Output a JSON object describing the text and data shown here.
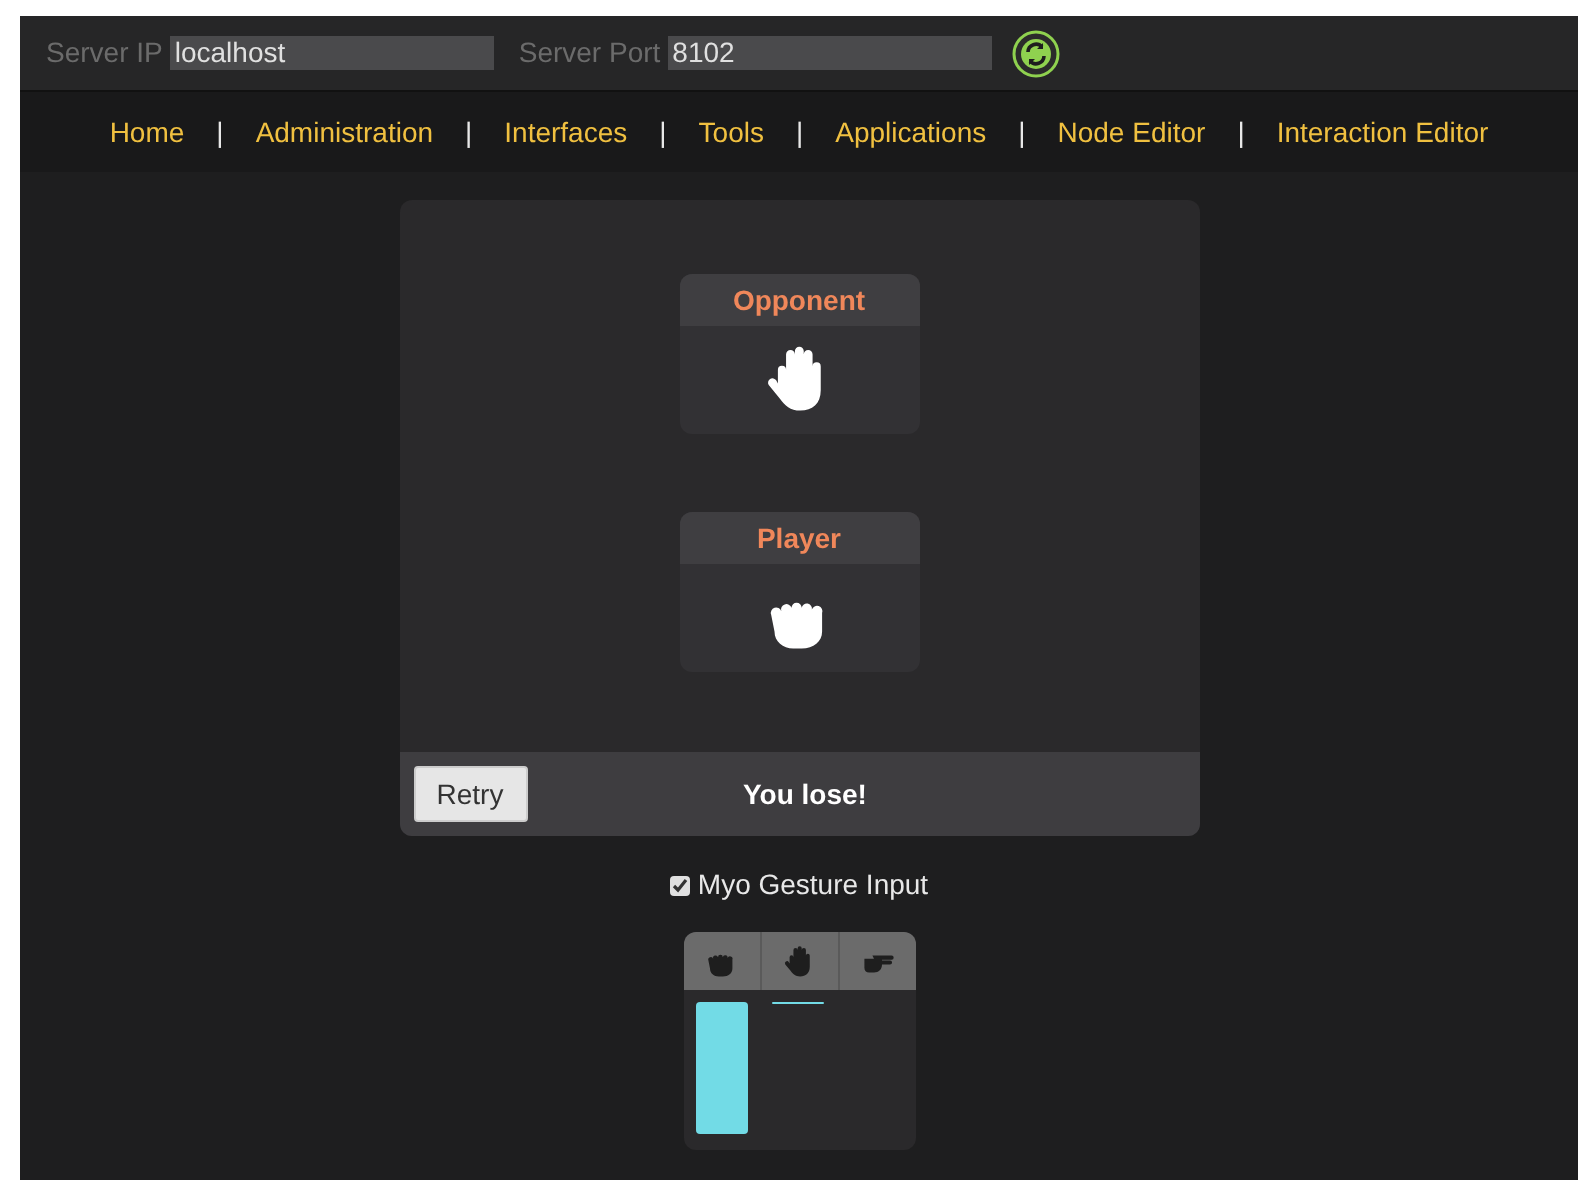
{
  "server": {
    "ip_label": "Server IP",
    "ip_value": "localhost",
    "port_label": "Server Port",
    "port_value": "8102"
  },
  "nav": [
    "Home",
    "Administration",
    "Interfaces",
    "Tools",
    "Applications",
    "Node Editor",
    "Interaction Editor"
  ],
  "nav_separator": "|",
  "game": {
    "hands": [
      {
        "title": "Opponent",
        "kind": "paper"
      },
      {
        "title": "Player",
        "kind": "rock"
      }
    ],
    "retry": "Retry",
    "result": "You lose!"
  },
  "myo": {
    "label": "Myo Gesture Input",
    "checked": true
  },
  "meter": [
    {
      "kind": "rock"
    },
    {
      "kind": "paper"
    },
    {
      "kind": "scissors"
    }
  ]
}
